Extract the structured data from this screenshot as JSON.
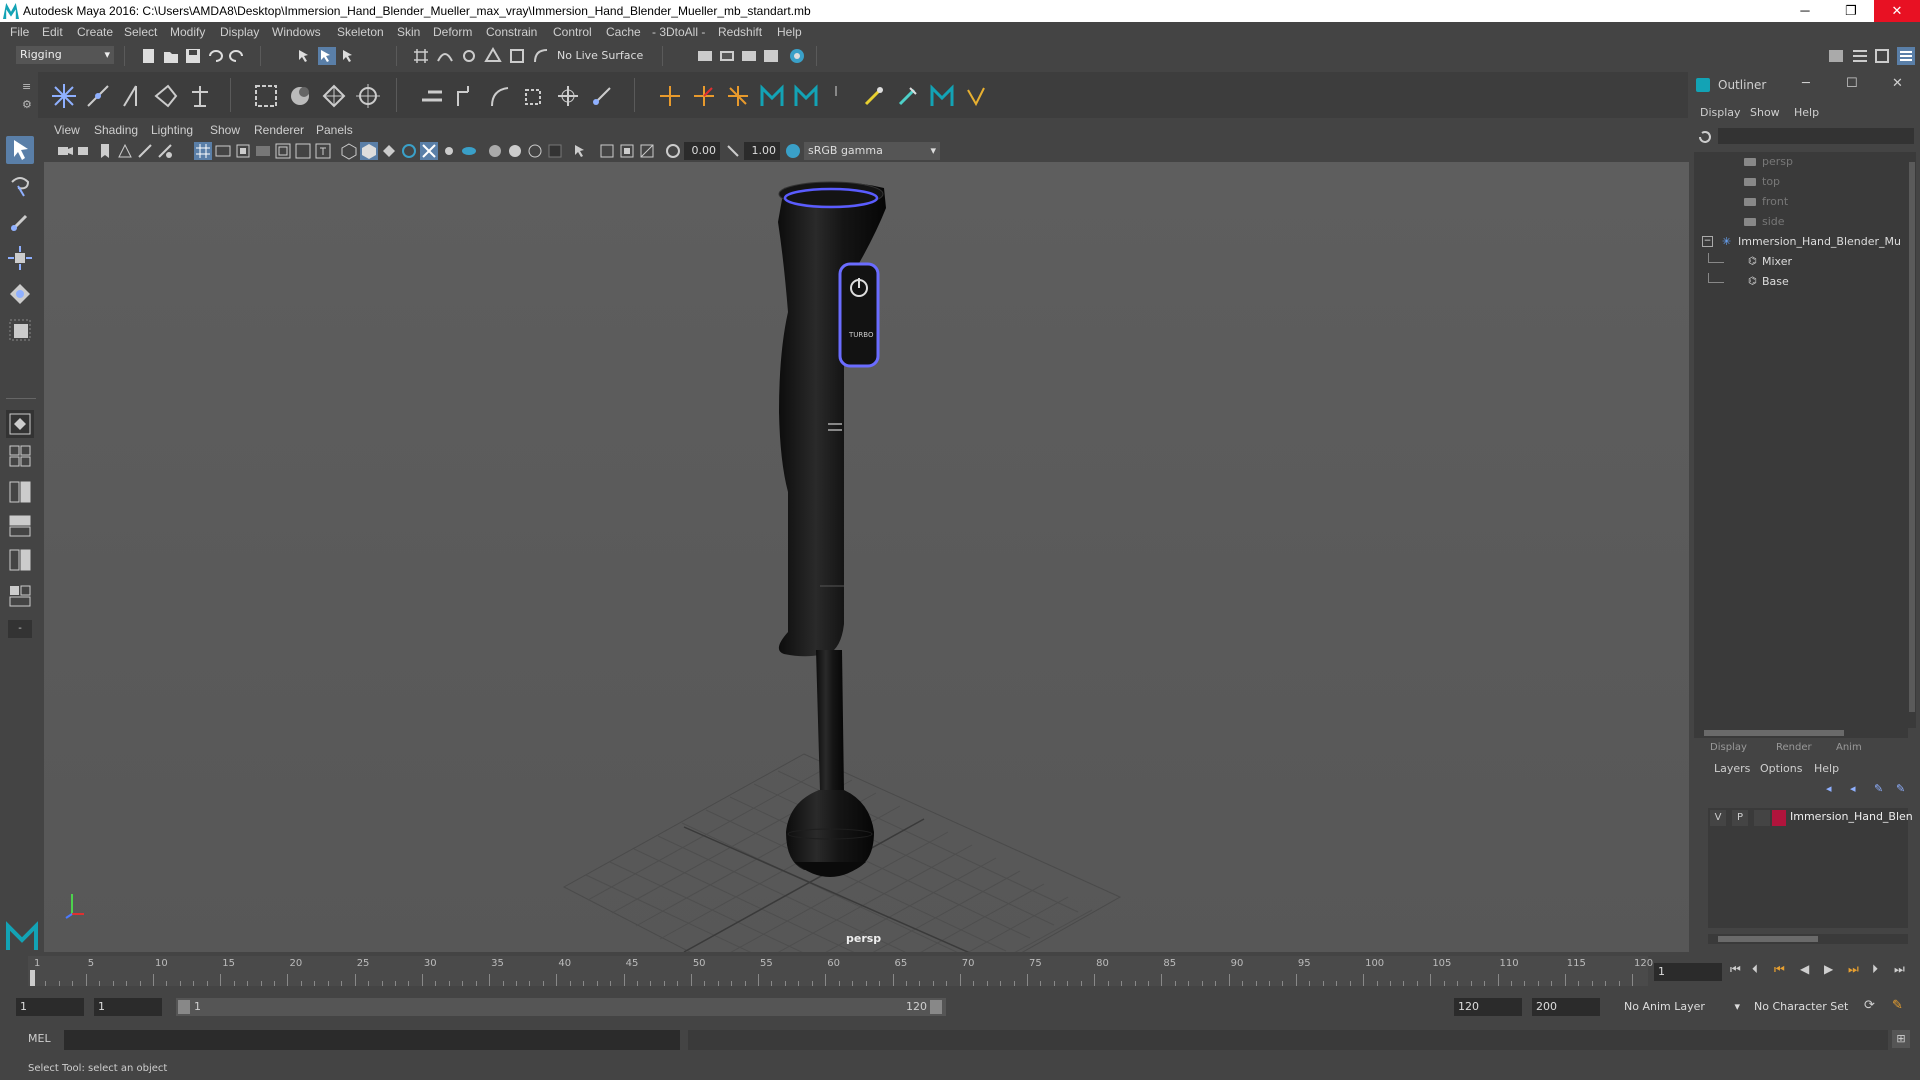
{
  "window": {
    "title": "Autodesk Maya 2016: C:\\Users\\AMDA8\\Desktop\\Immersion_Hand_Blender_Mueller_max_vray\\Immersion_Hand_Blender_Mueller_mb_standart.mb",
    "minimize": "─",
    "restore": "❐",
    "close": "✕"
  },
  "menubar": {
    "items": [
      "File",
      "Edit",
      "Create",
      "Select",
      "Modify",
      "Display",
      "Windows",
      "Skeleton",
      "Skin",
      "Deform",
      "Constrain",
      "Control",
      "Cache",
      "- 3DtoAll -",
      "Redshift",
      "Help"
    ]
  },
  "statusline": {
    "mode": "Rigging",
    "live_surface": "No Live Surface"
  },
  "viewport": {
    "menus": [
      "View",
      "Shading",
      "Lighting",
      "Show",
      "Renderer",
      "Panels"
    ],
    "exposure": "0.00",
    "gamma": "1.00",
    "color_space": "sRGB gamma",
    "camera_label": "persp"
  },
  "outliner": {
    "title": "Outliner",
    "menus": [
      "Display",
      "Show",
      "Help"
    ],
    "items": [
      {
        "label": "persp",
        "dim": true
      },
      {
        "label": "top",
        "dim": true
      },
      {
        "label": "front",
        "dim": true
      },
      {
        "label": "side",
        "dim": true
      },
      {
        "label": "Immersion_Hand_Blender_Mu",
        "dim": false
      },
      {
        "label": "Mixer",
        "dim": false
      },
      {
        "label": "Base",
        "dim": false
      }
    ]
  },
  "layers": {
    "tabs": [
      "Display",
      "Render",
      "Anim"
    ],
    "menus": [
      "Layers",
      "Options",
      "Help"
    ],
    "row": {
      "v": "V",
      "p": "P",
      "name": "Immersion_Hand_Blen",
      "color": "#b0143c"
    }
  },
  "timeline": {
    "ticks": [
      "1",
      "5",
      "10",
      "15",
      "20",
      "25",
      "30",
      "35",
      "40",
      "45",
      "50",
      "55",
      "60",
      "65",
      "70",
      "75",
      "80",
      "85",
      "90",
      "95",
      "100",
      "105",
      "110",
      "115",
      "120"
    ],
    "current_frame": "1"
  },
  "range": {
    "start": "1",
    "playback_start": "1",
    "slider_start": "1",
    "slider_end": "120",
    "playback_end": "120",
    "end": "200",
    "anim_layer": "No Anim Layer",
    "character_set": "No Character Set"
  },
  "cmd": {
    "label": "MEL"
  },
  "help": {
    "text": "Select Tool: select an object"
  },
  "colors": {
    "accent": "#13a3b5",
    "button_glow": "#6a6cff",
    "close": "#e81123"
  }
}
